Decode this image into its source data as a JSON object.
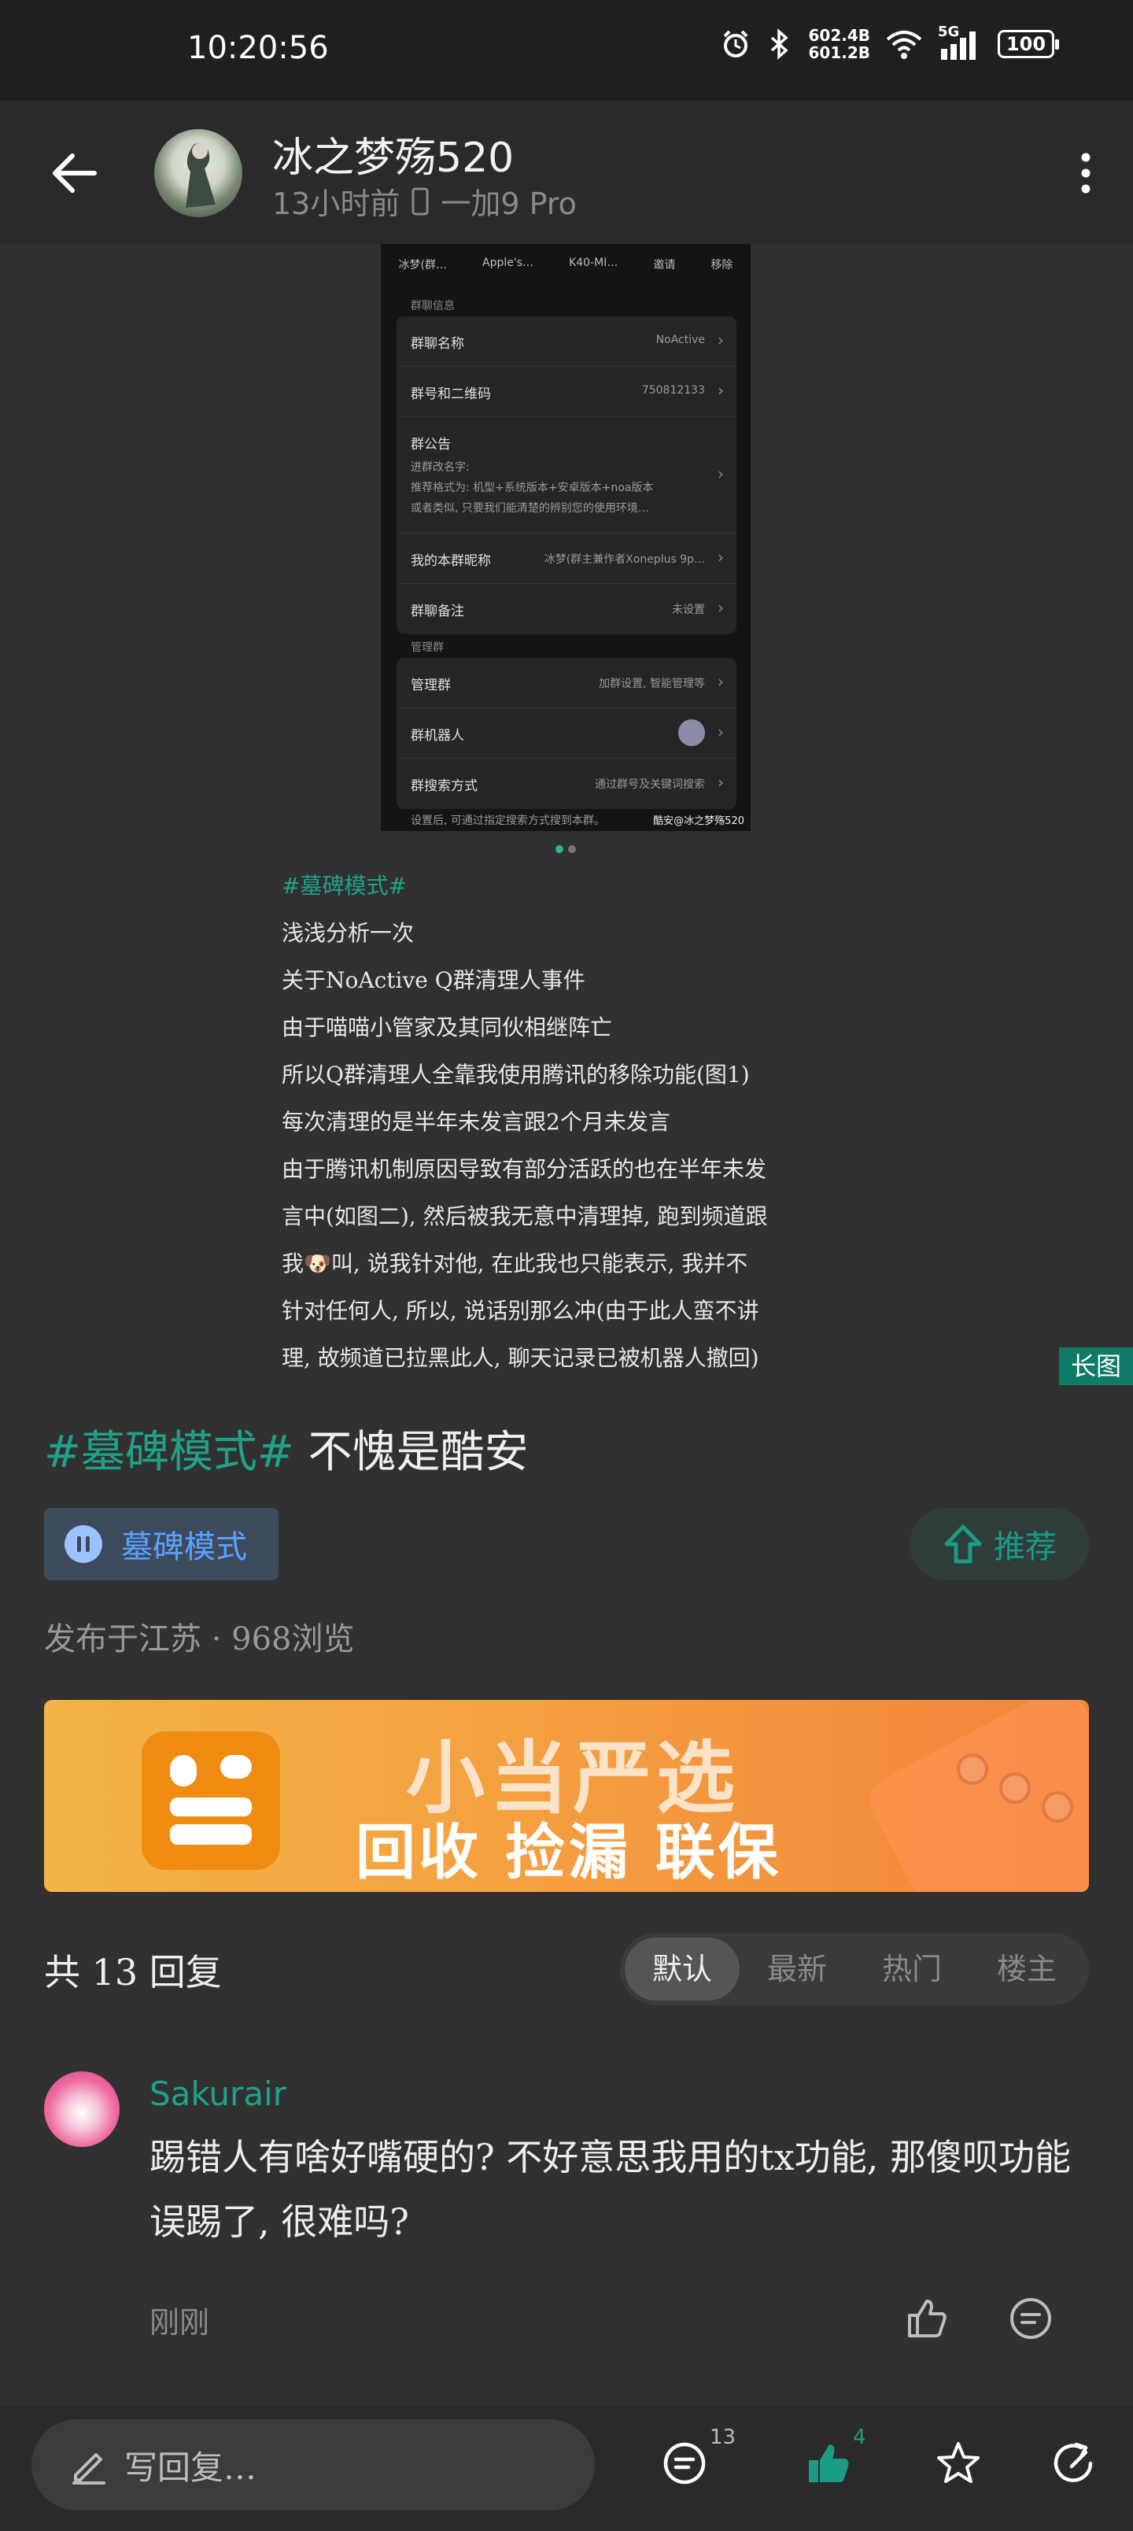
{
  "status_bar": {
    "time": "10:20:56",
    "net_up": "602.4B",
    "net_down": "601.2B",
    "signal_label": "5G",
    "battery": "100"
  },
  "header": {
    "username": "冰之梦殇520",
    "time_ago": "13小时前",
    "device": "一加9 Pro"
  },
  "image": {
    "top_row": [
      "冰梦(群…",
      "Apple's…",
      "K40-MI…",
      "邀请",
      "移除"
    ],
    "section1": "群聊信息",
    "group_name_label": "群聊名称",
    "group_name_value": "NoActive",
    "group_id_label": "群号和二维码",
    "group_id_value": "750812133",
    "announce_label": "群公告",
    "announce_line1": "进群改名字:",
    "announce_line2": "推荐格式为: 机型+系统版本+安卓版本+noa版本",
    "announce_line3": "或者类似, 只要我们能清楚的辨别您的使用环境…",
    "nickname_label": "我的本群昵称",
    "nickname_value": "冰梦(群主兼作者Xoneplus 9p…",
    "remark_label": "群聊备注",
    "remark_value": "未设置",
    "section2": "管理群",
    "manage_label": "管理群",
    "manage_value": "加群设置, 智能管理等",
    "robot_label": "群机器人",
    "search_label": "群搜索方式",
    "search_value": "通过群号及关键词搜索",
    "footer": "设置后, 可通过指定搜索方式搜到本群。",
    "watermark": "酷安@冰之梦殇520",
    "text_tag": "#墓碑模式#",
    "text_lines": [
      "浅浅分析一次",
      "关于NoActive Q群清理人事件",
      "由于喵喵小管家及其同伙相继阵亡",
      "所以Q群清理人全靠我使用腾讯的移除功能(图1)",
      "每次清理的是半年未发言跟2个月未发言",
      "由于腾讯机制原因导致有部分活跃的也在半年未发",
      "言中(如图二), 然后被我无意中清理掉, 跑到频道跟",
      "我🐶叫, 说我针对他, 在此我也只能表示, 我并不",
      "针对任何人, 所以, 说话别那么冲(由于此人蛮不讲",
      "理, 故频道已拉黑此人, 聊天记录已被机器人撤回)"
    ],
    "long_image_badge": "长图"
  },
  "post": {
    "title_tag": "#墓碑模式#",
    "title_text": " 不愧是酷安",
    "topic_chip": "墓碑模式",
    "recommend": "推荐",
    "location": "发布于江苏",
    "views": "968浏览"
  },
  "ad": {
    "line1": "小当严选",
    "line2": "回收 捡漏 联保"
  },
  "replies": {
    "count_label": "共 13 回复",
    "sort_tabs": [
      "默认",
      "最新",
      "热门",
      "楼主"
    ],
    "active_tab": "默认"
  },
  "comment": {
    "name": "Sakurair",
    "text": "踢错人有啥好嘴硬的? 不好意思我用的tx功能, 那傻呗功能误踢了, 很难吗?",
    "time": "刚刚"
  },
  "bottom_bar": {
    "placeholder": "写回复…",
    "reply_count": "13",
    "like_count": "4"
  },
  "colors": {
    "accent": "#1fa189",
    "background": "#303030",
    "topic_blue": "#5aa2ff"
  }
}
